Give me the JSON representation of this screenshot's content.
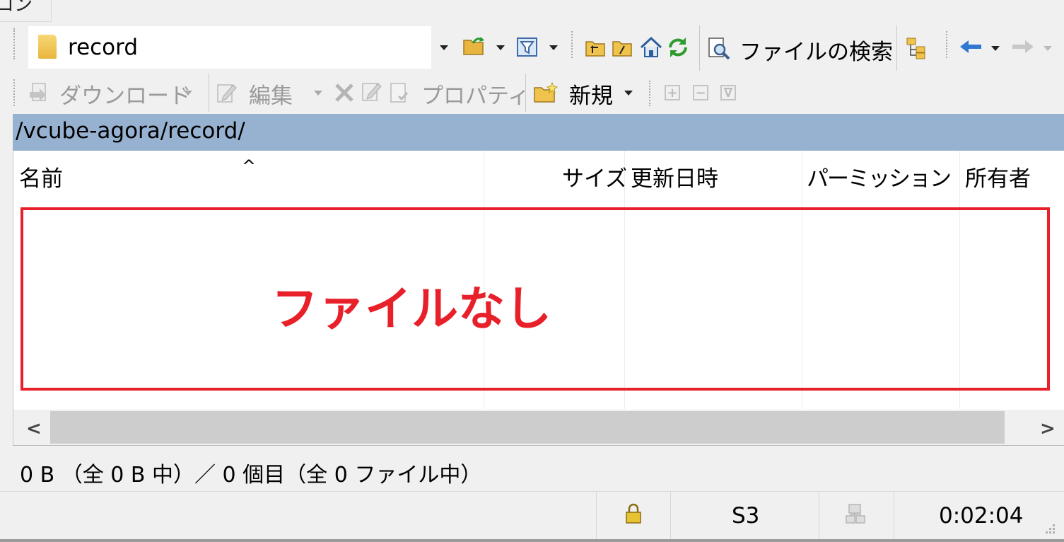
{
  "top_fragment": {
    "text": "コン"
  },
  "path_combo": {
    "value": "record",
    "icon": "folder-icon"
  },
  "search_button": {
    "label": "ファイルの検索"
  },
  "toolbar2": {
    "download_label": "ダウンロード",
    "edit_label": "編集",
    "properties_label": "プロパティ",
    "new_label": "新規"
  },
  "path_bar": {
    "path": "/vcube-agora/record/"
  },
  "columns": {
    "name": "名前",
    "size": "サイズ",
    "modified": "更新日時",
    "permissions": "パーミッション",
    "owner": "所有者"
  },
  "sort_indicator": "^",
  "annotation": {
    "text": "ファイルなし",
    "color": "#e8202a"
  },
  "status_info": "0 B （全 0 B 中）／ 0 個目（全 0 ファイル中）",
  "status_bar": {
    "protocol": "S3",
    "elapsed": "0:02:04",
    "lock_icon": "lock-icon",
    "network_icon": "network-icon"
  },
  "colors": {
    "path_bar_bg": "#97b2d0",
    "annotation_red": "#e8202a"
  }
}
